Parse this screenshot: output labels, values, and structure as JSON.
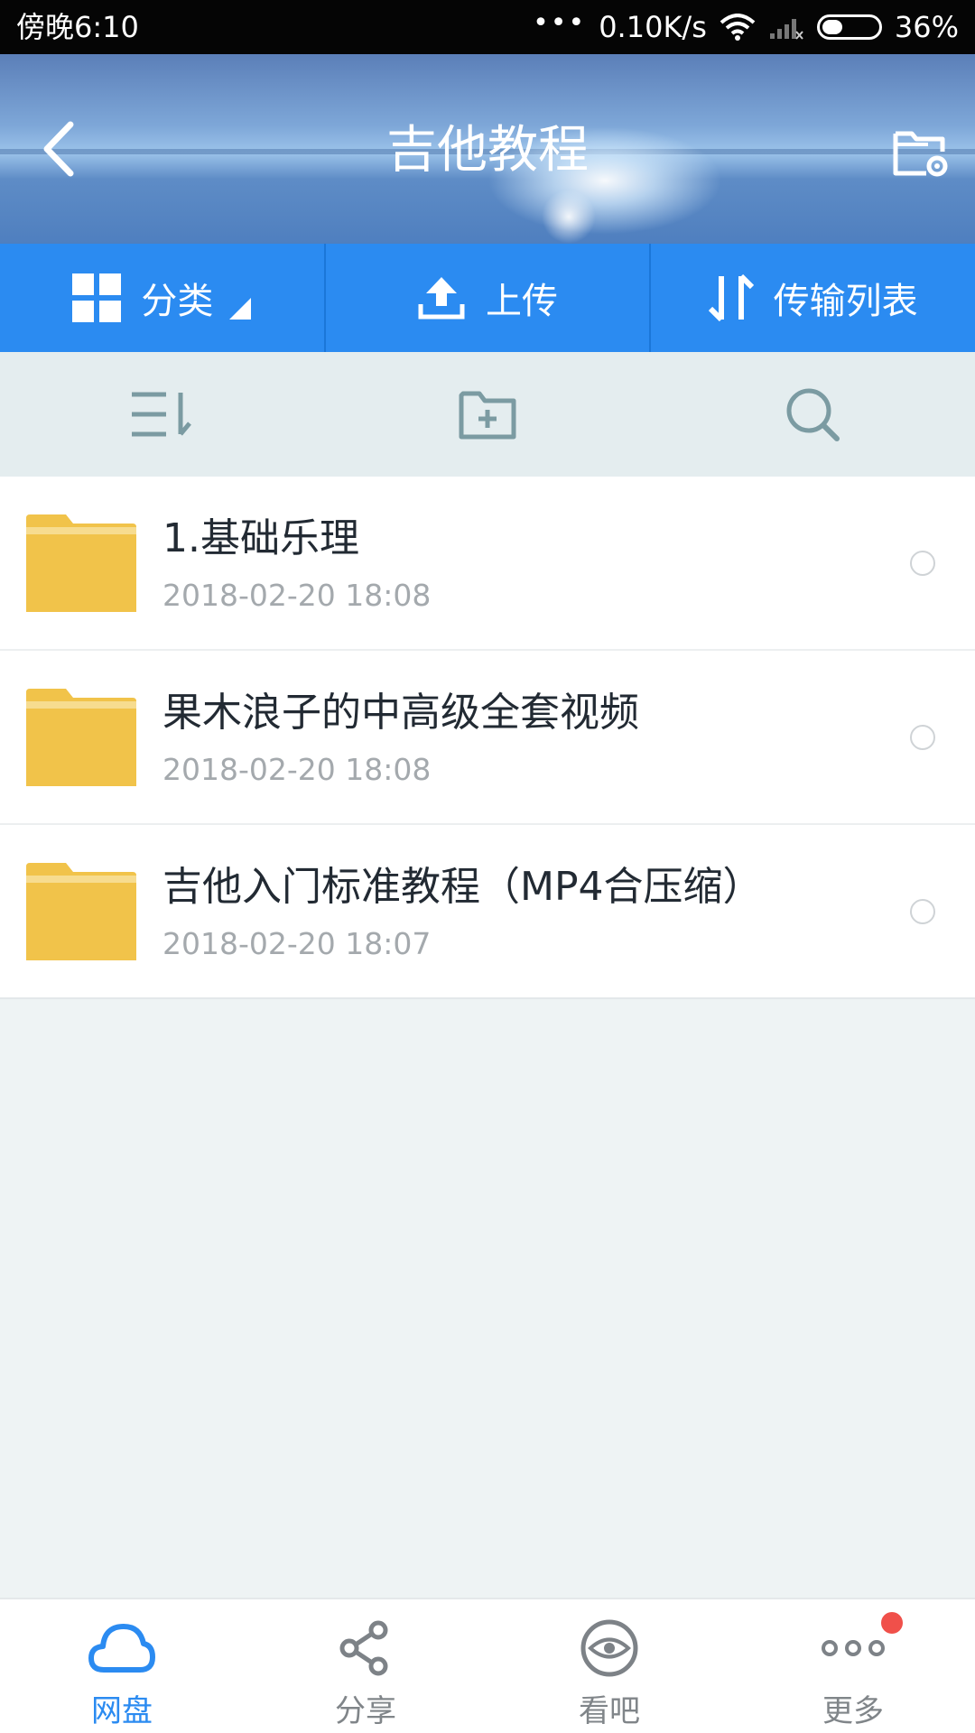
{
  "status_bar": {
    "time": "傍晚6:10",
    "dots": "•••",
    "speed": "0.10K/s",
    "battery": "36%",
    "battery_level": 0.36
  },
  "header": {
    "title": "吉他教程",
    "back_icon": "chevron-left-icon",
    "settings_icon": "folder-settings-icon"
  },
  "toolbar": {
    "category_label": "分类",
    "upload_label": "上传",
    "transfer_label": "传输列表"
  },
  "actions": {
    "sort_icon": "sort-icon",
    "new_folder_icon": "new-folder-icon",
    "search_icon": "search-icon"
  },
  "files": [
    {
      "name": "1.基础乐理",
      "date": "2018-02-20  18:08"
    },
    {
      "name": "果木浪子的中高级全套视频",
      "date": "2018-02-20  18:08"
    },
    {
      "name": "吉他入门标准教程（MP4合压缩）",
      "date": "2018-02-20  18:07"
    }
  ],
  "nav": [
    {
      "label": "网盘",
      "icon": "cloud-icon",
      "active": true
    },
    {
      "label": "分享",
      "icon": "share-icon",
      "active": false
    },
    {
      "label": "看吧",
      "icon": "eye-icon",
      "active": false
    },
    {
      "label": "更多",
      "icon": "more-icon",
      "active": false,
      "badge": true
    }
  ],
  "colors": {
    "accent": "#2b8bf1",
    "folder": "#f1c34a",
    "badge": "#f0504a"
  }
}
